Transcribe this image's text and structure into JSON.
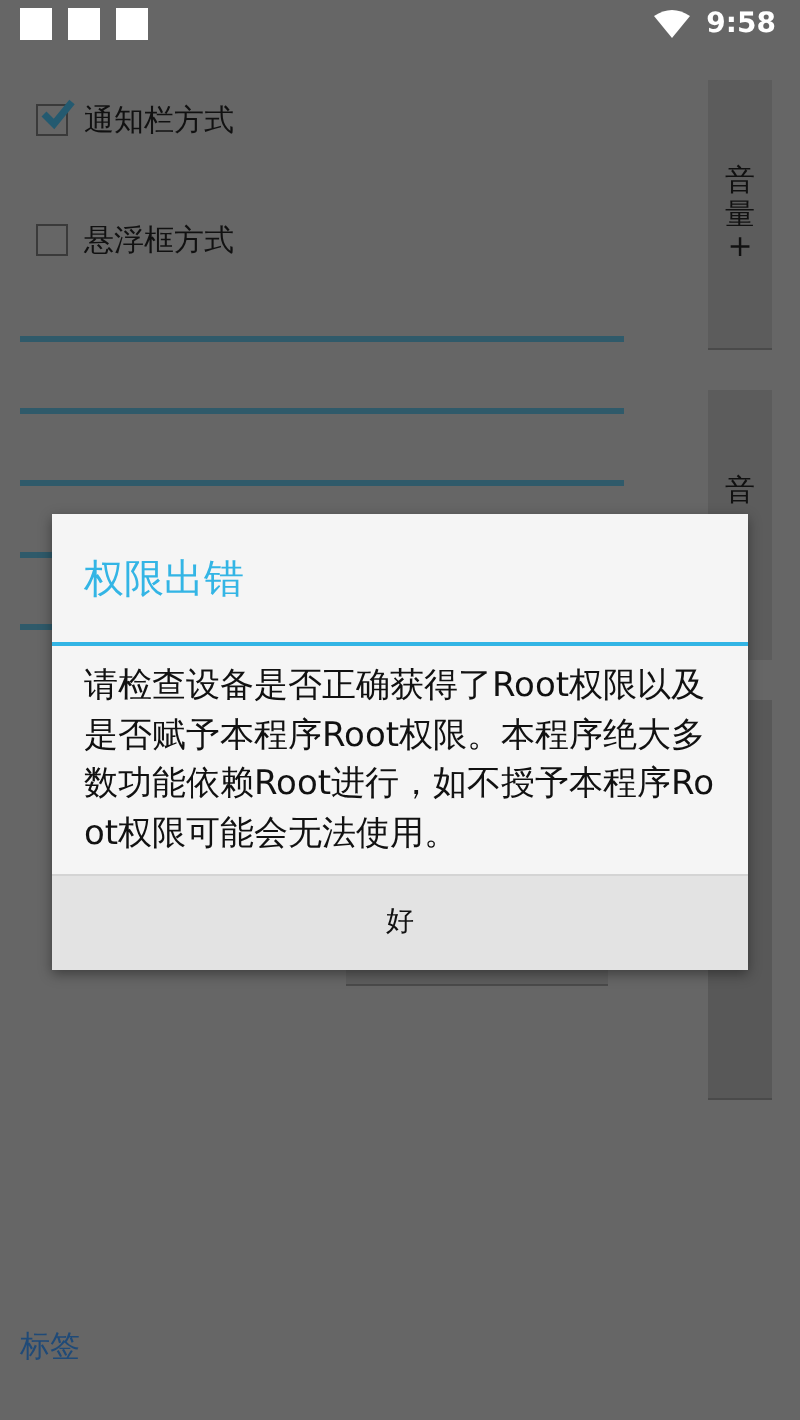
{
  "status_bar": {
    "time": "9:58"
  },
  "options": [
    {
      "label": "通知栏方式",
      "checked": true
    },
    {
      "label": "悬浮框方式",
      "checked": false
    }
  ],
  "side_buttons": [
    {
      "label": "音量+"
    },
    {
      "label": "音"
    }
  ],
  "tag_link": "标签",
  "dialog": {
    "title": "权限出错",
    "message": "请检查设备是否正确获得了Root权限以及是否赋予本程序Root权限。本程序绝大多数功能依赖Root进行，如不授予本程序Root权限可能会无法使用。",
    "button": "好"
  }
}
